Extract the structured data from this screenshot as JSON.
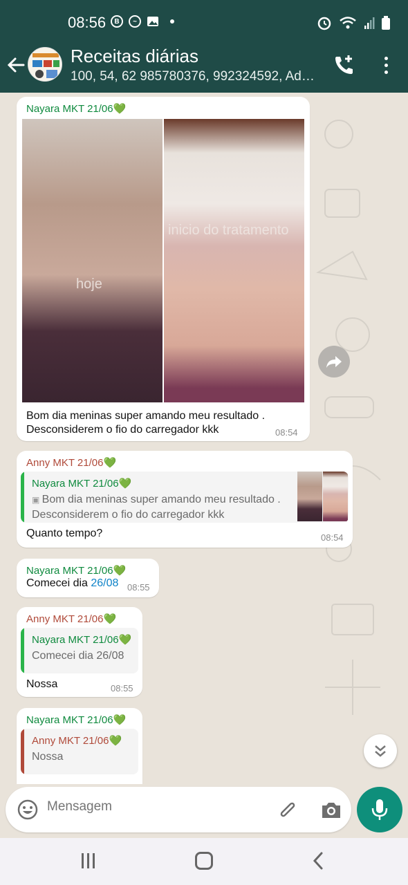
{
  "status_bar": {
    "time": "08:56"
  },
  "header": {
    "title": "Receitas diárias",
    "members": "100, 54, 62 985780376, 992324592, Adel..."
  },
  "messages": [
    {
      "sender": "Nayara MKT 21/06💚",
      "photo_labels": [
        "hoje",
        "inicio do tratamento"
      ],
      "text_line1": "Bom dia meninas super amando meu resultado .",
      "text_line2": "Desconsiderem o fio do carregador kkk",
      "time": "08:54"
    },
    {
      "sender": "Anny MKT 21/06💚",
      "quote_sender": "Nayara MKT 21/06💚",
      "quote_line1": "Bom dia meninas super amando meu resultado .",
      "quote_line2": "Desconsiderem o fio do carregador kkk",
      "text": "Quanto tempo?",
      "time": "08:54"
    },
    {
      "sender": "Nayara MKT 21/06💚",
      "text": "Comecei dia ",
      "link": "26/08",
      "time": "08:55"
    },
    {
      "sender": "Anny MKT 21/06💚",
      "quote_sender": "Nayara MKT 21/06💚",
      "quote_text": "Comecei dia 26/08",
      "text": "Nossa",
      "time": "08:55"
    },
    {
      "sender": "Nayara MKT 21/06💚",
      "quote_sender": "Anny MKT 21/06💚",
      "quote_text": "Nossa"
    }
  ],
  "input": {
    "placeholder": "Mensagem"
  },
  "colors": {
    "header": "#1f4b47",
    "accent": "#0e8f7b",
    "green_name": "#0f8a3e",
    "red_name": "#b04a3a"
  },
  "icons": [
    "back-arrow-icon",
    "add-call-icon",
    "more-options-icon",
    "forward-icon",
    "scroll-down-icon",
    "emoji-icon",
    "attach-icon",
    "camera-icon",
    "mic-icon"
  ]
}
